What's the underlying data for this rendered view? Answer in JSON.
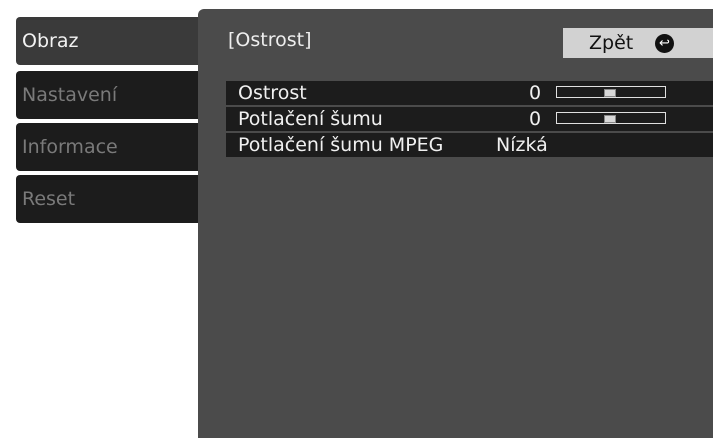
{
  "menu": {
    "items": [
      {
        "label": "Obraz",
        "active": true
      },
      {
        "label": "Nastavení",
        "active": false
      },
      {
        "label": "Informace",
        "active": false
      },
      {
        "label": "Reset",
        "active": false
      }
    ]
  },
  "panel": {
    "title": "[Ostrost]",
    "back_label": "Zpět",
    "back_icon": "return-arrow-icon",
    "rows": [
      {
        "label": "Ostrost",
        "value": "0",
        "slider_level": 0.5
      },
      {
        "label": "Potlačení šumu",
        "value": "0",
        "slider_level": 0.5
      },
      {
        "label": "Potlačení šumu MPEG",
        "value": "Nízká"
      }
    ]
  },
  "colors": {
    "panel_bg": "#4b4b4b",
    "row_bg": "#1c1c1c",
    "active_menu_bg": "#3a3a3a",
    "button_bg": "#d2d2d2"
  }
}
